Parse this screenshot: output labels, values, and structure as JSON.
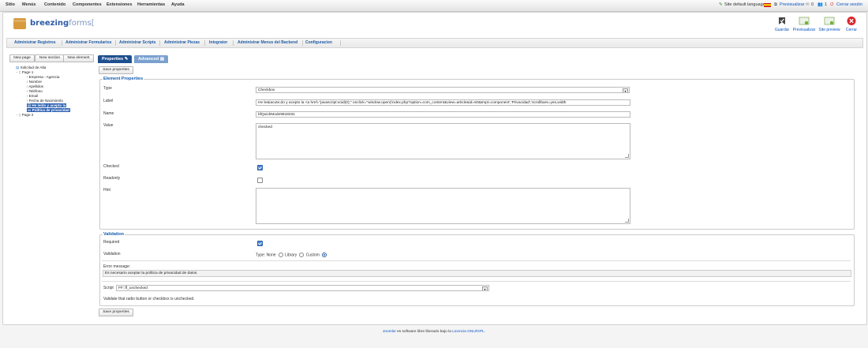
{
  "menubar": {
    "items": [
      "Sitio",
      "Menús",
      "Contenido",
      "Componentes",
      "Extensiones",
      "Herramientas",
      "Ayuda"
    ],
    "right": {
      "site_lang": "Site default language",
      "preview": "Previsualizar",
      "messages": "0",
      "users": "1",
      "logout": "Cerrar sesión"
    }
  },
  "header": {
    "logo_main": "breezing",
    "logo_rest": "forms",
    "toolbar": {
      "save": "Guardar",
      "preview": "Previsualizar",
      "site_preview": "Site preview",
      "close": "Cerrar"
    }
  },
  "subnav": [
    "Administrar Registros",
    "Administrar Formularios",
    "Administrar Scripts",
    "Administrar Piezas",
    "Integrator",
    "Administrar Menus del Backend",
    "Configuracion"
  ],
  "left_buttons": {
    "new_page": "New page",
    "new_section": "New section",
    "new_element": "New element"
  },
  "tree": {
    "root": "Solicitud de Alta",
    "page1": "Page 1",
    "items": [
      "Empresa - Agencia",
      "Nombre",
      "Apellidos",
      "Teléfono",
      "Email",
      "Fecha de Nacimiento"
    ],
    "checkbox_item": "He leído y acepto la",
    "selected_item": "Política de privacidad",
    "page2": "Page 2"
  },
  "tabs": {
    "properties": "Properties",
    "advanced": "Advanced"
  },
  "save_properties": "Save properties",
  "element_properties": {
    "legend": "Element Properties",
    "type_label": "Type",
    "type_value": "Checkbox",
    "label_label": "Label",
    "label_value": "He le&iacute;do y acepto la <a href=\"javascript:void(0);\" onclick=\"window.open('index.php?option=com_content&view=article&id=50&tmpl=component','Privacidad','scrollbars=yes,width",
    "name_label": "Name",
    "name_value": "bfQuickMode9818331",
    "value_label": "Value",
    "value_value": "checked",
    "checked_label": "Checked",
    "checked": true,
    "readonly_label": "Readonly",
    "readonly": false,
    "hint_label": "Hint",
    "hint_value": ""
  },
  "validation": {
    "legend": "Validation",
    "required_label": "Required",
    "required": true,
    "validation_label": "Validation",
    "type_prefix": "Type:",
    "options": [
      "None",
      "Library",
      "Custom"
    ],
    "selected": "Custom",
    "error_label": "Error message:",
    "error_value": "Es necesario aceptar la política de privacidad de datos.",
    "script_label": "Script",
    "script_value": "FF::ff_unchecked",
    "script_desc": "Validate that radio button or checkbox is unchecked."
  },
  "footer": {
    "link": "Joomla!",
    "text": " es software libre liberado bajo la ",
    "license": "Licencia GNU/GPL."
  },
  "colors": {
    "accent": "#135cae",
    "tab_active": "#1e4f8f",
    "tab_inactive": "#7aa1cf",
    "close_red": "#d9262b"
  }
}
